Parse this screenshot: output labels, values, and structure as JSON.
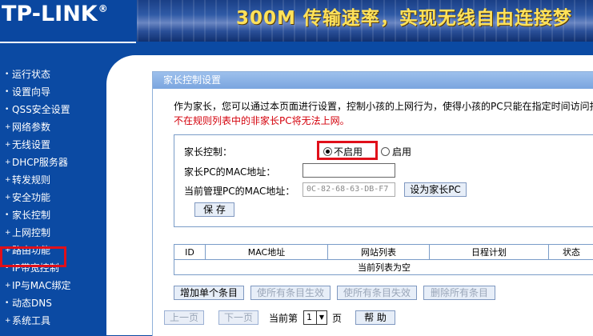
{
  "brand": {
    "logo": "TP-LINK",
    "reg": "®"
  },
  "banner": {
    "text": "300M 传输速率，实现无线自由连接梦"
  },
  "sidebar": {
    "items": [
      {
        "label": "运行状态"
      },
      {
        "label": "设置向导"
      },
      {
        "label": "QSS安全设置"
      },
      {
        "label": "网络参数"
      },
      {
        "label": "无线设置"
      },
      {
        "label": "DHCP服务器"
      },
      {
        "label": "转发规则"
      },
      {
        "label": "安全功能"
      },
      {
        "label": "家长控制"
      },
      {
        "label": "上网控制"
      },
      {
        "label": "路由功能"
      },
      {
        "label": "IP带宽控制"
      },
      {
        "label": "IP与MAC绑定"
      },
      {
        "label": "动态DNS"
      },
      {
        "label": "系统工具"
      }
    ],
    "active": "家长控制"
  },
  "panel": {
    "title": "家长控制设置",
    "desc_line1": "作为家长，您可以通过本页面进行设置，控制小孩的上网行为，使得小孩的PC只能在指定时间访问指",
    "desc_line2": "不在规则列表中的非家长PC将无法上网。"
  },
  "form": {
    "parental_label": "家长控制：",
    "off_label": "不启用",
    "on_label": "启用",
    "selected": "off",
    "parent_mac_label": "家长PC的MAC地址：",
    "parent_mac_value": "",
    "current_mac_label": "当前管理PC的MAC地址：",
    "current_mac_value": "0C-82-68-63-DB-F7",
    "set_parent_button": "设为家长PC",
    "save_button": "保 存"
  },
  "table": {
    "headers": [
      "ID",
      "MAC地址",
      "网站列表",
      "日程计划",
      "状态"
    ],
    "empty_text": "当前列表为空"
  },
  "actions": {
    "add": "增加单个条目",
    "enable_all": "使所有条目生效",
    "disable_all": "使所有条目失效",
    "delete_all": "删除所有条目"
  },
  "pager": {
    "prev": "上一页",
    "next": "下一页",
    "current_prefix": "当前第",
    "page_value": "1",
    "page_suffix": "页",
    "help": "帮 助"
  },
  "colors": {
    "brand_blue": "#0a47a0",
    "highlight_red": "#e0101a",
    "warning_red": "#d4000b"
  }
}
